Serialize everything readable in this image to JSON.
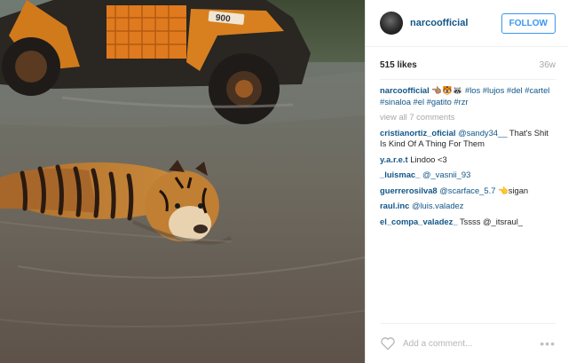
{
  "post": {
    "username": "narcoofficial",
    "follow_label": "FOLLOW",
    "likes": "515 likes",
    "time": "36w",
    "caption_user": "narcoofficial",
    "caption_emoji": "👈🏽🐯🦝",
    "caption_tags": "#los #lujos #del #cartel #sinaloa #el #gatito #rzr",
    "view_all": "view all 7 comments"
  },
  "comments": [
    {
      "user": "cristianortiz_oficial",
      "mention": "@sandy34__",
      "text": " That's Shit Is Kind Of A Thing For Them"
    },
    {
      "user": "y.a.r.e.t",
      "mention": "",
      "text": "Lindoo <3"
    },
    {
      "user": "_luismac_",
      "mention": "@_vasnii_93",
      "text": ""
    },
    {
      "user": "guerrerosilva8",
      "mention": "@scarface_5.7",
      "text": " 👈sigan"
    },
    {
      "user": "raul.inc",
      "mention": "@luis.valadez",
      "text": ""
    },
    {
      "user": "el_compa_valadez_",
      "mention": "",
      "text": "Tssss @_itsraul_"
    }
  ],
  "footer": {
    "add_comment_placeholder": "Add a comment...",
    "more": "•••",
    "heart_icon": "heart-outline-icon"
  },
  "photo": {
    "vehicle_number": "900"
  }
}
